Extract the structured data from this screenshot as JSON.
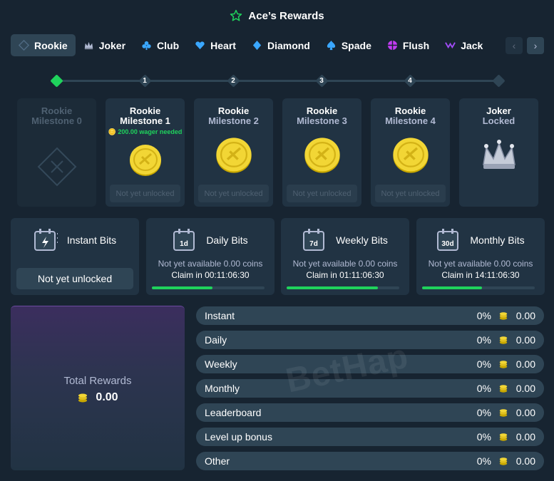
{
  "header": {
    "title": "Ace’s Rewards",
    "icon": "star-icon",
    "accent": "#1fd35c"
  },
  "tabs": [
    {
      "label": "Rookie",
      "icon": "rookie-icon",
      "active": true
    },
    {
      "label": "Joker",
      "icon": "joker-hat-icon"
    },
    {
      "label": "Club",
      "icon": "club-icon"
    },
    {
      "label": "Heart",
      "icon": "heart-icon"
    },
    {
      "label": "Diamond",
      "icon": "diamond-icon"
    },
    {
      "label": "Spade",
      "icon": "spade-icon"
    },
    {
      "label": "Flush",
      "icon": "flush-icon"
    },
    {
      "label": "Jack",
      "icon": "jack-icon"
    }
  ],
  "track": {
    "nodes": [
      "",
      "1",
      "2",
      "3",
      "4",
      ""
    ]
  },
  "milestones": [
    {
      "title": "Rookie",
      "sub": "Milestone 0",
      "status": ""
    },
    {
      "title": "Rookie",
      "sub": "Milestone 1",
      "wager": "200.00 wager needed",
      "status": "Not yet unlocked"
    },
    {
      "title": "Rookie",
      "sub": "Milestone 2",
      "status": "Not yet unlocked"
    },
    {
      "title": "Rookie",
      "sub": "Milestone 3",
      "status": "Not yet unlocked"
    },
    {
      "title": "Rookie",
      "sub": "Milestone 4",
      "status": "Not yet unlocked"
    },
    {
      "title": "Joker",
      "sub": "Locked",
      "status": ""
    }
  ],
  "bits": [
    {
      "name": "Instant Bits",
      "badge": "",
      "button": "Not yet unlocked"
    },
    {
      "name": "Daily Bits",
      "badge": "1d",
      "avail": "Not yet available 0.00 coins",
      "claim": "Claim in 00:11:06:30",
      "progress": 0.54
    },
    {
      "name": "Weekly Bits",
      "badge": "7d",
      "avail": "Not yet available 0.00 coins",
      "claim": "Claim in 01:11:06:30",
      "progress": 0.81
    },
    {
      "name": "Monthly Bits",
      "badge": "30d",
      "avail": "Not yet available 0.00 coins",
      "claim": "Claim in 14:11:06:30",
      "progress": 0.53
    }
  ],
  "total": {
    "label": "Total Rewards",
    "value": "0.00"
  },
  "breakdown": [
    {
      "name": "Instant",
      "pct": "0%",
      "amount": "0.00"
    },
    {
      "name": "Daily",
      "pct": "0%",
      "amount": "0.00"
    },
    {
      "name": "Weekly",
      "pct": "0%",
      "amount": "0.00"
    },
    {
      "name": "Monthly",
      "pct": "0%",
      "amount": "0.00"
    },
    {
      "name": "Leaderboard",
      "pct": "0%",
      "amount": "0.00"
    },
    {
      "name": "Level up bonus",
      "pct": "0%",
      "amount": "0.00"
    },
    {
      "name": "Other",
      "pct": "0%",
      "amount": "0.00"
    }
  ],
  "watermark": "BetHap"
}
